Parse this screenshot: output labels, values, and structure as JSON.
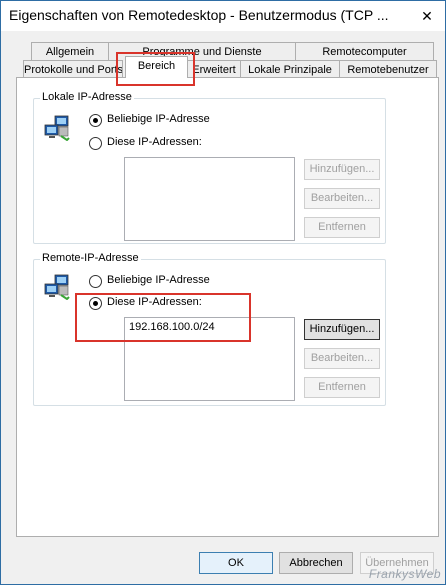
{
  "window": {
    "title": "Eigenschaften von Remotedesktop - Benutzermodus (TCP ...",
    "close_symbol": "✕"
  },
  "tabs": {
    "row1": [
      {
        "label": "Allgemein"
      },
      {
        "label": "Programme und Dienste"
      },
      {
        "label": "Remotecomputer"
      }
    ],
    "row2": [
      {
        "label": "Protokolle und Ports"
      },
      {
        "label": "Bereich",
        "active": true
      },
      {
        "label": "Erweitert"
      },
      {
        "label": "Lokale Prinzipale"
      },
      {
        "label": "Remotebenutzer"
      }
    ]
  },
  "local_ip": {
    "title": "Lokale IP-Adresse",
    "icon": "network-computers-icon",
    "option_any": "Beliebige IP-Adresse",
    "option_these": "Diese IP-Adressen:",
    "selected": "any",
    "addresses": [],
    "buttons": {
      "add": "Hinzufügen...",
      "edit": "Bearbeiten...",
      "remove": "Entfernen"
    }
  },
  "remote_ip": {
    "title": "Remote-IP-Adresse",
    "icon": "network-computers-icon",
    "option_any": "Beliebige IP-Adresse",
    "option_these": "Diese IP-Adressen:",
    "selected": "these",
    "addresses": [
      "192.168.100.0/24"
    ],
    "buttons": {
      "add": "Hinzufügen...",
      "edit": "Bearbeiten...",
      "remove": "Entfernen"
    }
  },
  "footer": {
    "ok": "OK",
    "cancel": "Abbrechen",
    "apply": "Übernehmen"
  },
  "watermark": "FrankysWeb",
  "colors": {
    "highlight": "#d9342b",
    "window_border": "#2e6da4"
  }
}
